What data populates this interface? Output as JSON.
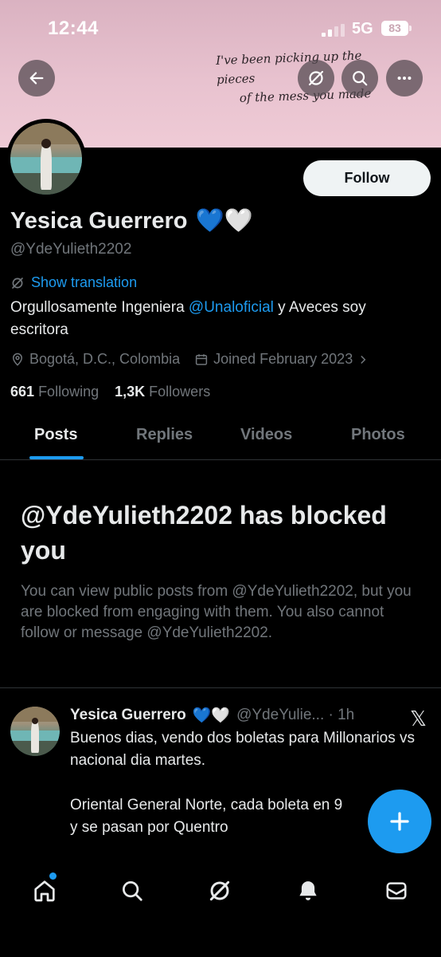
{
  "status_bar": {
    "time": "12:44",
    "network": "5G",
    "battery": "83"
  },
  "banner": {
    "handwriting_line1": "I've been picking up the pieces",
    "handwriting_line2": "of the mess you made"
  },
  "header_buttons": {
    "back": "back-arrow-icon",
    "grok": "grok-icon",
    "search": "search-icon",
    "more": "more-icon"
  },
  "profile": {
    "follow_label": "Follow",
    "name": "Yesica Guerrero",
    "name_hearts": "💙🤍",
    "handle": "@YdeYulieth2202",
    "show_translation": "Show translation",
    "bio_prefix": "Orgullosamente Ingeniera ",
    "bio_mention": "@Unaloficial",
    "bio_suffix": " y Aveces soy escritora",
    "location": "Bogotá, D.C., Colombia",
    "joined": "Joined February 2023",
    "following_count": "661",
    "following_label": "Following",
    "followers_count": "1,3K",
    "followers_label": "Followers"
  },
  "tabs": [
    {
      "label": "Posts",
      "active": true
    },
    {
      "label": "Replies",
      "active": false
    },
    {
      "label": "Videos",
      "active": false
    },
    {
      "label": "Photos",
      "active": false
    }
  ],
  "blocked": {
    "title": "@YdeYulieth2202 has blocked you",
    "text": "You can view public posts from @YdeYulieth2202, but you are blocked from engaging with them. You also cannot follow or message @YdeYulieth2202."
  },
  "post": {
    "name": "Yesica Guerrero",
    "hearts": "💙🤍",
    "handle_time": "@YdeYulie... · 1h",
    "body": "Buenos dias, vendo dos boletas para Millonarios vs nacional dia martes.\n\nOriental General Norte, cada boleta en 9\ny se pasan por Quentro",
    "x_logo": "𝕏"
  },
  "fab": {
    "icon": "plus-icon"
  },
  "bottom_nav": [
    "home-icon",
    "search-icon",
    "grok-icon",
    "notifications-icon",
    "messages-icon"
  ],
  "colors": {
    "accent": "#1d9bf0",
    "banner": "#e8c2cf",
    "background": "#000000",
    "muted": "#71767b"
  }
}
